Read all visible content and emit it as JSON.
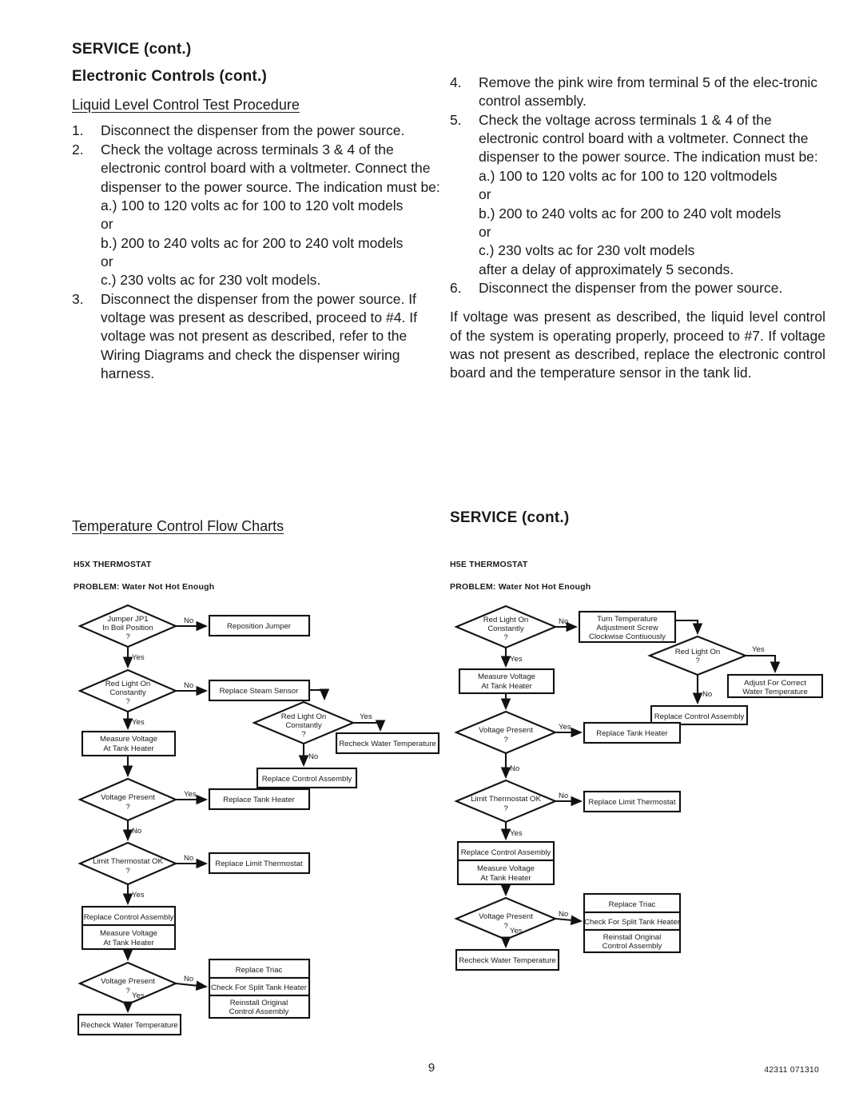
{
  "document": {
    "page_number": "9",
    "doc_id": "42311 071310"
  },
  "left_column": {
    "title": "SERVICE (cont.)",
    "subtitle": "Electronic Controls (cont.)",
    "section_heading": "Liquid Level Control Test Procedure",
    "steps": [
      {
        "num": "1.",
        "text": "Disconnect the dispenser from the power source."
      },
      {
        "num": "2.",
        "text": "Check the voltage across terminals 3 & 4 of the electronic control board with a voltmeter.  Connect the dispenser to the power source. The indication must be:",
        "sub": [
          "a.) 100 to 120 volts ac for 100 to 120 volt models",
          "or",
          "b.) 200 to 240 volts ac for 200 to 240 volt models",
          "or",
          "c.) 230 volts ac for 230 volt models."
        ]
      },
      {
        "num": "3.",
        "text": "Disconnect the dispenser from the power source. If voltage was present as described, proceed to #4. If voltage was not present as described, refer to the Wiring Diagrams and check the dispenser wiring harness."
      }
    ],
    "flow_charts_heading": "Temperature Control Flow Charts",
    "chart_model": "H5X THERMOSTAT",
    "chart_problem": "PROBLEM: Water Not Hot Enough"
  },
  "right_column": {
    "steps": [
      {
        "num": "4.",
        "text": "Remove the pink wire from terminal 5 of the elec-tronic control assembly."
      },
      {
        "num": "5.",
        "text": "Check the voltage across terminals 1 & 4 of the electronic control board with a voltmeter.  Connect the dispenser to the power source. The indication must be:",
        "sub": [
          "a.) 100 to 120 volts ac for 100 to 120 voltmodels",
          "or",
          "b.) 200 to 240 volts ac for 200 to 240 volt models",
          "or",
          "c.) 230 volts ac for 230 volt models",
          "after a delay of approximately 5 seconds."
        ]
      },
      {
        "num": "6.",
        "text": "Disconnect the dispenser from the power source."
      }
    ],
    "closing_paragraph": "If voltage was present as described, the liquid level control of the system is operating properly, proceed to #7. If voltage was not present as described, replace the electronic control board and the temperature sensor in the tank lid.",
    "title": "SERVICE (cont.)",
    "chart_model": "H5E THERMOSTAT",
    "chart_problem": "PROBLEM: Water Not Hot Enough"
  },
  "chart_data": {
    "type": "diagram",
    "title": "Temperature Control Flow Charts",
    "charts": [
      {
        "name": "H5X THERMOSTAT",
        "problem": "PROBLEM: Water Not Hot Enough",
        "nodes": [
          {
            "id": "x1",
            "shape": "decision",
            "text": [
              "Jumper JP1",
              "In Boil Position",
              "?"
            ]
          },
          {
            "id": "x2",
            "shape": "process",
            "text": [
              "Reposition Jumper"
            ]
          },
          {
            "id": "x3",
            "shape": "decision",
            "text": [
              "Red Light On",
              "Constantly",
              "?"
            ]
          },
          {
            "id": "x4",
            "shape": "process",
            "text": [
              "Replace Steam Sensor"
            ]
          },
          {
            "id": "x5",
            "shape": "decision",
            "text": [
              "Red Light On",
              "Constantly",
              "?"
            ]
          },
          {
            "id": "x6",
            "shape": "process",
            "text": [
              "Recheck Water Temperature"
            ]
          },
          {
            "id": "x7",
            "shape": "process",
            "text": [
              "Replace Control Assembly"
            ]
          },
          {
            "id": "x8",
            "shape": "process",
            "text": [
              "Measure Voltage",
              "At Tank Heater"
            ]
          },
          {
            "id": "x9",
            "shape": "decision",
            "text": [
              "Voltage Present",
              "?"
            ]
          },
          {
            "id": "x10",
            "shape": "process",
            "text": [
              "Replace Tank Heater"
            ]
          },
          {
            "id": "x11",
            "shape": "decision",
            "text": [
              "Limit Thermostat OK",
              "?"
            ]
          },
          {
            "id": "x12",
            "shape": "process",
            "text": [
              "Replace Limit Thermostat"
            ]
          },
          {
            "id": "x13",
            "shape": "process",
            "text": [
              "Replace Control Assembly"
            ]
          },
          {
            "id": "x14",
            "shape": "process",
            "text": [
              "Measure Voltage",
              "At Tank Heater"
            ]
          },
          {
            "id": "x15",
            "shape": "decision",
            "text": [
              "Voltage Present",
              "?"
            ]
          },
          {
            "id": "x16",
            "shape": "process",
            "text": [
              "Replace Triac"
            ]
          },
          {
            "id": "x17",
            "shape": "process",
            "text": [
              "Check For Split Tank Heater"
            ]
          },
          {
            "id": "x18",
            "shape": "process",
            "text": [
              "Reinstall Original",
              "Control Assembly"
            ]
          },
          {
            "id": "x19",
            "shape": "process",
            "text": [
              "Recheck Water Temperature"
            ]
          }
        ],
        "edges": [
          {
            "from": "x1",
            "to": "x2",
            "label": "No"
          },
          {
            "from": "x1",
            "to": "x3",
            "label": "Yes"
          },
          {
            "from": "x3",
            "to": "x4",
            "label": "No"
          },
          {
            "from": "x4",
            "to": "x5",
            "label": ""
          },
          {
            "from": "x5",
            "to": "x6",
            "label": "Yes"
          },
          {
            "from": "x5",
            "to": "x7",
            "label": "No"
          },
          {
            "from": "x3",
            "to": "x8",
            "label": "Yes"
          },
          {
            "from": "x8",
            "to": "x9",
            "label": ""
          },
          {
            "from": "x9",
            "to": "x10",
            "label": "Yes"
          },
          {
            "from": "x9",
            "to": "x11",
            "label": "No"
          },
          {
            "from": "x11",
            "to": "x12",
            "label": "No"
          },
          {
            "from": "x11",
            "to": "x13",
            "label": "Yes"
          },
          {
            "from": "x14",
            "to": "x15",
            "label": ""
          },
          {
            "from": "x15",
            "to": "x17",
            "label": "No"
          },
          {
            "from": "x15",
            "to": "x19",
            "label": "Yes"
          }
        ]
      },
      {
        "name": "H5E THERMOSTAT",
        "problem": "PROBLEM: Water Not Hot Enough",
        "nodes": [
          {
            "id": "e1",
            "shape": "decision",
            "text": [
              "Red Light On",
              "Constantly",
              "?"
            ]
          },
          {
            "id": "e2",
            "shape": "process",
            "text": [
              "Turn Temperature",
              "Adjustment Screw",
              "Clockwise Contiuously"
            ]
          },
          {
            "id": "e3",
            "shape": "decision",
            "text": [
              "Red Light On",
              "?"
            ]
          },
          {
            "id": "e4",
            "shape": "process",
            "text": [
              "Adjust For Correct",
              "Water Temperature"
            ]
          },
          {
            "id": "e5",
            "shape": "process",
            "text": [
              "Replace Control Assembly"
            ]
          },
          {
            "id": "e6",
            "shape": "process",
            "text": [
              "Measure Voltage",
              "At Tank Heater"
            ]
          },
          {
            "id": "e7",
            "shape": "decision",
            "text": [
              "Voltage Present",
              "?"
            ]
          },
          {
            "id": "e8",
            "shape": "process",
            "text": [
              "Replace Tank Heater"
            ]
          },
          {
            "id": "e9",
            "shape": "decision",
            "text": [
              "Limit Thermostat OK",
              "?"
            ]
          },
          {
            "id": "e10",
            "shape": "process",
            "text": [
              "Replace Limit Thermostat"
            ]
          },
          {
            "id": "e11",
            "shape": "process",
            "text": [
              "Replace Control Assembly"
            ]
          },
          {
            "id": "e12",
            "shape": "process",
            "text": [
              "Measure Voltage",
              "At Tank Heater"
            ]
          },
          {
            "id": "e13",
            "shape": "decision",
            "text": [
              "Voltage Present",
              "?"
            ]
          },
          {
            "id": "e14",
            "shape": "process",
            "text": [
              "Replace Triac"
            ]
          },
          {
            "id": "e15",
            "shape": "process",
            "text": [
              "Check For Split Tank Heater"
            ]
          },
          {
            "id": "e16",
            "shape": "process",
            "text": [
              "Reinstall Original",
              "Control Assembly"
            ]
          },
          {
            "id": "e17",
            "shape": "process",
            "text": [
              "Recheck Water Temperature"
            ]
          }
        ],
        "edges": [
          {
            "from": "e1",
            "to": "e2",
            "label": "No"
          },
          {
            "from": "e2",
            "to": "e3",
            "label": ""
          },
          {
            "from": "e3",
            "to": "e4",
            "label": "Yes"
          },
          {
            "from": "e3",
            "to": "e5",
            "label": "No"
          },
          {
            "from": "e1",
            "to": "e6",
            "label": "Yes"
          },
          {
            "from": "e6",
            "to": "e7",
            "label": ""
          },
          {
            "from": "e7",
            "to": "e8",
            "label": "Yes"
          },
          {
            "from": "e7",
            "to": "e9",
            "label": "No"
          },
          {
            "from": "e9",
            "to": "e10",
            "label": "No"
          },
          {
            "from": "e9",
            "to": "e11",
            "label": "Yes"
          },
          {
            "from": "e12",
            "to": "e13",
            "label": ""
          },
          {
            "from": "e13",
            "to": "e15",
            "label": "No"
          },
          {
            "from": "e13",
            "to": "e17",
            "label": "Yes"
          }
        ]
      }
    ]
  }
}
